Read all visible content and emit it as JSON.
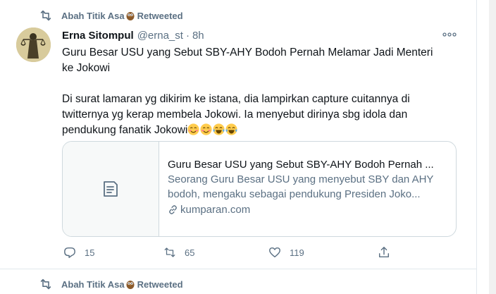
{
  "retweet_banner_top": {
    "user": "Abah Titik Asa",
    "label": "Retweeted"
  },
  "tweet": {
    "display_name": "Erna Sitompul",
    "handle": "@erna_st",
    "separator": "·",
    "time": "8h",
    "text_line1": "Guru Besar USU yang Sebut SBY-AHY Bodoh Pernah Melamar Jadi Menteri",
    "text_line2": "ke Jokowi",
    "text_line3": "Di surat lamaran yg dikirim ke istana, dia lampirkan capture cuitannya di",
    "text_line4": "twitternya yg kerap membela Jokowi. Ia menyebut dirinya sbg idola dan",
    "text_line5": "pendukung fanatik Jokowi",
    "emojis": [
      "smiling-face-icon",
      "smiling-face-icon",
      "tears-of-joy-icon",
      "tears-of-joy-icon"
    ]
  },
  "link_card": {
    "title": "Guru Besar USU yang Sebut SBY-AHY Bodoh Pernah ...",
    "desc_line1": "Seorang Guru Besar USU yang menyebut SBY dan AHY",
    "desc_line2": "bodoh, mengaku sebagai pendukung Presiden Joko...",
    "domain": "kumparan.com"
  },
  "actions": {
    "replies": "15",
    "retweets": "65",
    "likes": "119"
  },
  "retweet_banner_bottom": {
    "user": "Abah Titik Asa",
    "label": "Retweeted"
  },
  "colors": {
    "primary_text": "#0f1419",
    "secondary_text": "#5b7083",
    "border": "#cfd9de"
  }
}
